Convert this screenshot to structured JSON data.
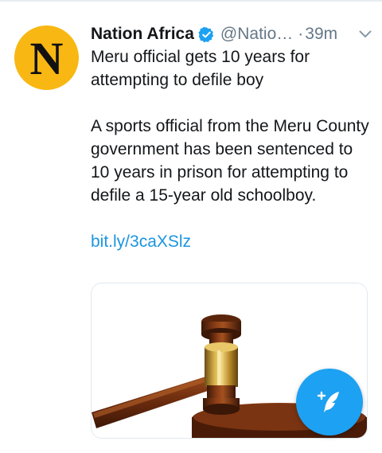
{
  "tweet": {
    "display_name": "Nation Africa",
    "handle": "@Natio…",
    "dot": "·",
    "timestamp": "39m",
    "avatar_letter": "N",
    "headline": "Meru official gets 10 years for attempting to defile boy",
    "body": "A sports official from the Meru County government has been sentenced to 10 years in prison for attempting to defile a 15-year old schoolboy.",
    "link": "bit.ly/3caXSlz"
  },
  "colors": {
    "accent": "#1da1f2",
    "link": "#1b95e0",
    "secondary_text": "#657786",
    "avatar_bg": "#f8b713"
  },
  "icons": {
    "verified": "verified-badge-icon",
    "menu": "chevron-down-icon",
    "compose": "compose-tweet-icon"
  }
}
